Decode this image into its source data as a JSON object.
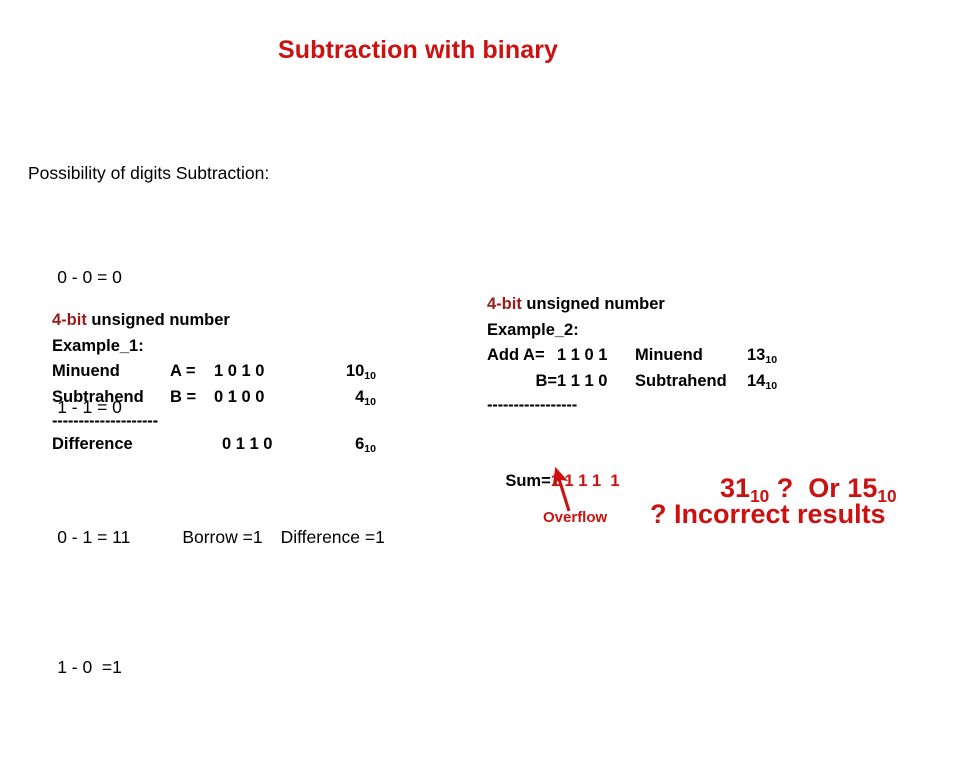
{
  "slide": {
    "title": "Subtraction with binary",
    "title_color": "#CC1111",
    "accent_dark_red": "#9B1B1B",
    "background": "#FFFFFF"
  },
  "rules": {
    "heading": "Possibility of digits Subtraction:",
    "lines": [
      {
        "expr": "0 - 0 = 0",
        "borrow": "",
        "difference": ""
      },
      {
        "expr": "1 - 1 = 0",
        "borrow": "",
        "difference": ""
      },
      {
        "expr": "0 - 1 = 11",
        "borrow": "Borrow =1",
        "difference": "Difference =1"
      },
      {
        "expr": "1 - 0  =1",
        "borrow": "",
        "difference": ""
      }
    ]
  },
  "example_1": {
    "header_accent": "4-bit",
    "header_rest": " unsigned number",
    "label": "Example_1:",
    "rows": [
      {
        "name": "Minuend",
        "var": "A =",
        "bits": "1 0 1 0",
        "dec": "10",
        "sub": "10"
      },
      {
        "name": "Subtrahend",
        "var": "B =",
        "bits": "0 1 0 0",
        "dec": "4",
        "sub": "10"
      }
    ],
    "separator": "--------------------",
    "result": {
      "name": "Difference",
      "bits": "0 1 1 0",
      "dec": "6",
      "sub": "10"
    }
  },
  "example_2": {
    "header_accent": "4-bit",
    "header_rest": " unsigned number",
    "label": "Example_2:",
    "rows": [
      {
        "op": "Add A=",
        "bits": "1 1 0 1",
        "role": "Minuend",
        "dec": "13",
        "sub": "10"
      },
      {
        "op": "B=",
        "bits": "1 1 1 0",
        "role": "Subtrahend",
        "dec": "14",
        "sub": "10"
      }
    ],
    "separator": "-----------------",
    "sum": {
      "label": "Sum=",
      "bits": "1 1 1 1  1"
    },
    "result_question": {
      "value_a": "31",
      "value_a_sub": "10",
      "connector": " ?  Or ",
      "value_b": "15",
      "value_b_sub": "10"
    },
    "overflow_label": "Overflow",
    "incorrect_text": "? Incorrect results"
  }
}
